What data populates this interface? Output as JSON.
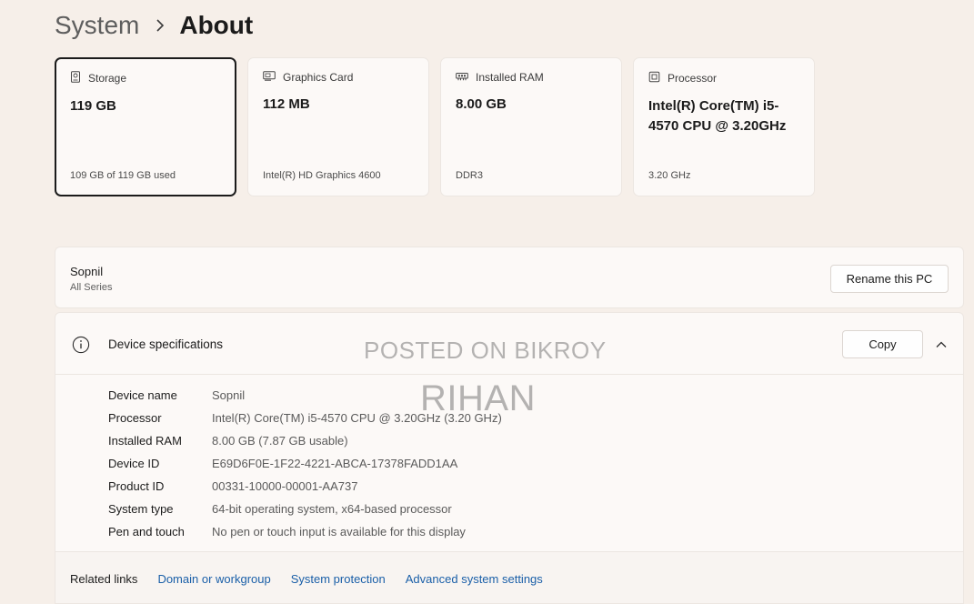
{
  "breadcrumb": {
    "parent": "System",
    "current": "About"
  },
  "cards": [
    {
      "icon": "storage-icon",
      "title": "Storage",
      "value": "119 GB",
      "sub": "109 GB of 119 GB used"
    },
    {
      "icon": "graphics-card-icon",
      "title": "Graphics Card",
      "value": "112 MB",
      "sub": "Intel(R) HD Graphics 4600"
    },
    {
      "icon": "ram-icon",
      "title": "Installed RAM",
      "value": "8.00 GB",
      "sub": "DDR3"
    },
    {
      "icon": "processor-icon",
      "title": "Processor",
      "value": "Intel(R) Core(TM) i5-4570 CPU @ 3.20GHz",
      "sub": "3.20 GHz"
    }
  ],
  "pc": {
    "name": "Sopnil",
    "model": "All Series",
    "rename_label": "Rename this PC"
  },
  "specs": {
    "title": "Device specifications",
    "copy_label": "Copy",
    "rows": [
      {
        "label": "Device name",
        "value": "Sopnil"
      },
      {
        "label": "Processor",
        "value": "Intel(R) Core(TM) i5-4570 CPU @ 3.20GHz (3.20 GHz)"
      },
      {
        "label": "Installed RAM",
        "value": "8.00 GB (7.87 GB usable)"
      },
      {
        "label": "Device ID",
        "value": "E69D6F0E-1F22-4221-ABCA-17378FADD1AA"
      },
      {
        "label": "Product ID",
        "value": "00331-10000-00001-AA737"
      },
      {
        "label": "System type",
        "value": "64-bit operating system, x64-based processor"
      },
      {
        "label": "Pen and touch",
        "value": "No pen or touch input is available for this display"
      }
    ]
  },
  "related": {
    "title": "Related links",
    "links": [
      "Domain or workgroup",
      "System protection",
      "Advanced system settings"
    ]
  },
  "watermark": {
    "line1": "POSTED ON BIKROY",
    "line2": "RIHAN"
  },
  "colors": {
    "accent_link": "#1a5fa8",
    "background": "#f6efe9",
    "card": "#fcf9f7"
  }
}
